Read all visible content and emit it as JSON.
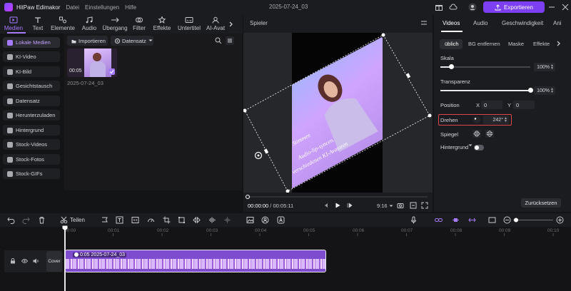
{
  "app": {
    "name": "HitPaw Edimakor",
    "menu": [
      "Datei",
      "Einstellungen",
      "Hilfe"
    ],
    "project_title": "2025-07-24_03",
    "export_label": "Exportieren"
  },
  "media_tabs": [
    {
      "label": "Medien",
      "icon": "media-icon"
    },
    {
      "label": "Text",
      "icon": "text-icon"
    },
    {
      "label": "Elemente",
      "icon": "elements-icon"
    },
    {
      "label": "Audio",
      "icon": "audio-icon"
    },
    {
      "label": "Übergang",
      "icon": "transition-icon"
    },
    {
      "label": "Filter",
      "icon": "filter-icon"
    },
    {
      "label": "Effekte",
      "icon": "effects-icon"
    },
    {
      "label": "Untertitel",
      "icon": "subtitle-icon"
    },
    {
      "label": "AI-Avat",
      "icon": "ai-avatar-icon"
    }
  ],
  "sidebar": {
    "items": [
      {
        "label": "Lokale Medien",
        "active": true
      },
      {
        "label": "KI-Video",
        "active": false
      },
      {
        "label": "KI-Bild",
        "active": false
      },
      {
        "label": "Gesichtstausch",
        "active": false
      },
      {
        "label": "Datensatz",
        "active": false
      },
      {
        "label": "Herunterzuladen",
        "active": false
      },
      {
        "label": "Hintergrund",
        "active": false
      },
      {
        "label": "Stock-Videos",
        "active": false
      },
      {
        "label": "Stock-Fotos",
        "active": false
      },
      {
        "label": "Stock-GIFs",
        "active": false
      }
    ]
  },
  "media": {
    "import_label": "Importieren",
    "dataset_label": "Datensatz",
    "item": {
      "duration": "00:05",
      "name": "2025-07-24_03"
    }
  },
  "player": {
    "title": "Spieler",
    "current_time": "00:00:00",
    "total_time": "00:05:11",
    "time_separator": "/",
    "aspect_ratio": "9:16",
    "overlay_texts": [
      "or",
      "ltar",
      "Stimmen",
      "Audio-lip-syncen.",
      "verschiedenen KI-Avataren"
    ]
  },
  "props": {
    "tabs": [
      "Videos",
      "Audio",
      "Geschwindigkeit",
      "Ani"
    ],
    "subtabs": [
      "üblich",
      "BG entfernen",
      "Maske",
      "Effekte"
    ],
    "scale_label": "Skala",
    "scale_value": "100%",
    "scale_level": 0.12,
    "transparency_label": "Transparenz",
    "transparency_value": "100%",
    "transparency_level": 1.0,
    "position_label": "Position",
    "x_label": "X",
    "x_value": "0",
    "y_label": "Y",
    "y_value": "0",
    "rotate_label": "Drehen",
    "rotate_value": "242°",
    "mirror_label": "Spiegel",
    "background_label": "Hintergrund",
    "reset_label": "Zurücksetzen",
    "highlight_color": "#e0454a"
  },
  "timeline": {
    "split_label": "Teilen",
    "ticks": [
      "00:00",
      "00:01",
      "00:02",
      "00:03",
      "00:04",
      "00:05",
      "00:06",
      "00:07",
      "00:08",
      "00:09",
      "00:10"
    ],
    "cover_label": "Cover",
    "clip": {
      "duration": "0:05",
      "name": "2025-07-24_03"
    }
  },
  "colors": {
    "accent": "#a77bff",
    "export": "#7c3ff2",
    "clip": "#7e4ccf"
  }
}
